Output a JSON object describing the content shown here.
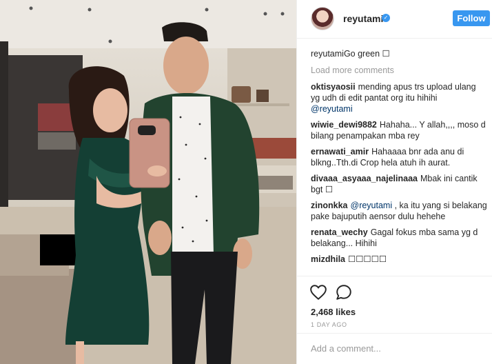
{
  "post": {
    "username": "reyutami",
    "follow_label": "Follow",
    "caption_user": "reyutami",
    "caption_text": "Go green ☐",
    "load_more": "Load more comments",
    "likes": "2,468 likes",
    "time_ago": "1 DAY AGO",
    "add_comment_placeholder": "Add a comment..."
  },
  "comments": [
    {
      "user": "oktisyaosii",
      "text": "mending apus trs upload ulang yg udh di edit pantat org itu hihihi",
      "mention": "@reyutami"
    },
    {
      "user": "wiwie_dewi9882",
      "text": "Hahaha... Y allah,,,, moso d bilang penampakan mba rey"
    },
    {
      "user": "ernawati_amir",
      "text": "Hahaaaa bnr ada anu di blkng..Tth.di Crop hela atuh ih aurat."
    },
    {
      "user": "divaaa_asyaaa_najelinaaa",
      "text": "Mbak ini cantik bgt ☐"
    },
    {
      "user": "zinonkka",
      "mention": "@reyutami",
      "text": ", ka itu yang si belakang pake bajuputih aensor dulu hehehe"
    },
    {
      "user": "renata_wechy",
      "text": "Gagal fokus mba sama yg d belakang... Hihihi"
    },
    {
      "user": "mizdhila",
      "text": "☐☐☐☐☐"
    }
  ],
  "icons": {
    "avatar": "profile-avatar",
    "verified": "verified-badge-icon",
    "like": "heart-icon",
    "comment": "comment-bubble-icon"
  },
  "colors": {
    "accent": "#3897f0",
    "mention": "#003569",
    "muted": "#999999"
  }
}
